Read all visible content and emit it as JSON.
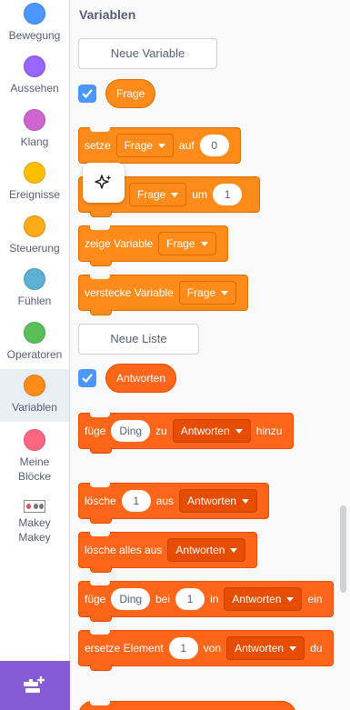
{
  "categories": [
    {
      "label": "Bewegung",
      "color": "#4c97ff"
    },
    {
      "label": "Aussehen",
      "color": "#9966ff"
    },
    {
      "label": "Klang",
      "color": "#cf63cf"
    },
    {
      "label": "Ereignisse",
      "color": "#ffbf00"
    },
    {
      "label": "Steuerung",
      "color": "#ffab19"
    },
    {
      "label": "Fühlen",
      "color": "#5cb1d6"
    },
    {
      "label": "Operatoren",
      "color": "#59c059"
    },
    {
      "label": "Variablen",
      "color": "#ff8c1a"
    },
    {
      "label_line1": "Meine",
      "label_line2": "Blöcke",
      "color": "#ff6680"
    },
    {
      "label_line1": "Makey",
      "label_line2": "Makey",
      "icon": "makey-makey-icon"
    }
  ],
  "palette": {
    "heading": "Variablen",
    "new_variable_button": "Neue Variable",
    "variable_reporter": "Frage",
    "set_block": {
      "text1": "setze",
      "dropdown": "Frage",
      "text2": "auf",
      "value": "0"
    },
    "change_block": {
      "dropdown": "Frage",
      "text2": "um",
      "value": "1"
    },
    "show_var_block": {
      "text1": "zeige Variable",
      "dropdown": "Frage"
    },
    "hide_var_block": {
      "text1": "verstecke Variable",
      "dropdown": "Frage"
    },
    "new_list_button": "Neue Liste",
    "list_reporter": "Antworten",
    "add_block": {
      "text1": "füge",
      "value": "Ding",
      "text2": "zu",
      "dropdown": "Antworten",
      "text3": "hinzu"
    },
    "delete_block": {
      "text1": "lösche",
      "value": "1",
      "text2": "aus",
      "dropdown": "Antworten"
    },
    "delete_all_block": {
      "text1": "lösche alles aus",
      "dropdown": "Antworten"
    },
    "insert_block": {
      "text1": "füge",
      "value1": "Ding",
      "text2": "bei",
      "value2": "1",
      "text3": "in",
      "dropdown": "Antworten",
      "text4": "ein"
    },
    "replace_block": {
      "text1": "ersetze Element",
      "value": "1",
      "text2": "von",
      "dropdown": "Antworten",
      "text3": "du"
    }
  }
}
